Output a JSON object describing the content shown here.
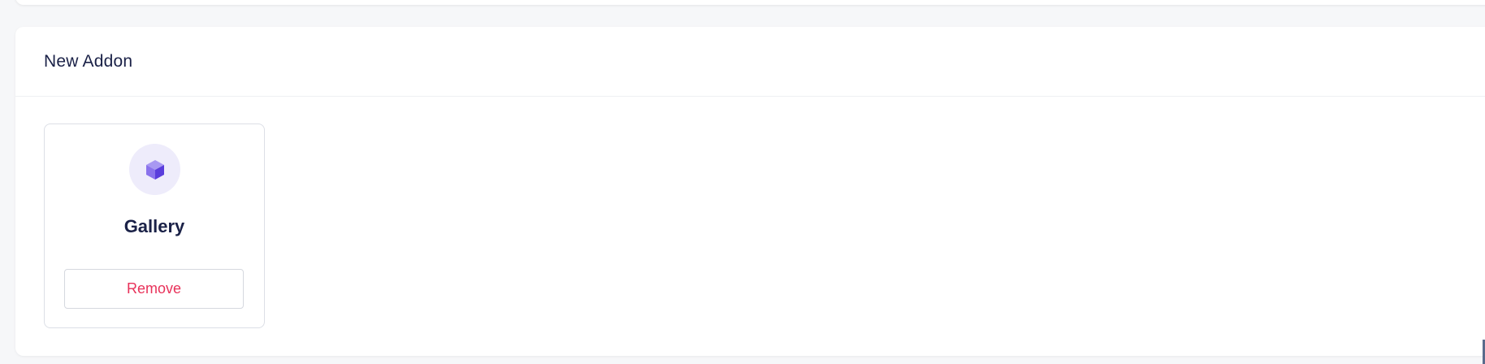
{
  "section": {
    "title": "New Addon"
  },
  "addons": [
    {
      "name": "Gallery",
      "icon": "cube-icon",
      "action_label": "Remove"
    }
  ],
  "colors": {
    "accent": "#6a4ee0",
    "danger": "#e8325a",
    "title": "#1a2147"
  }
}
